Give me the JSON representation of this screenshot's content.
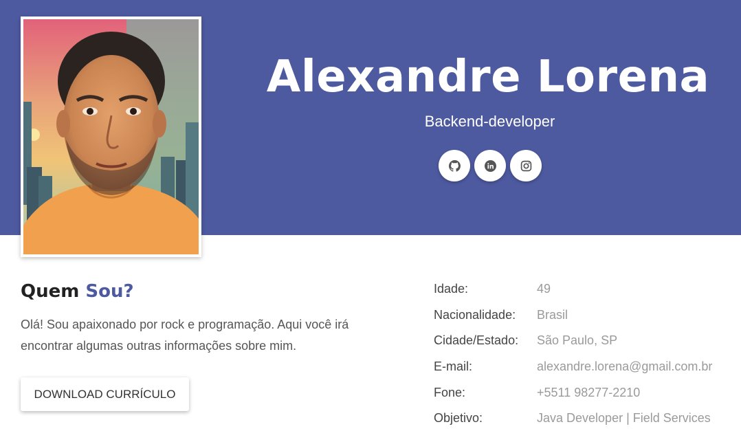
{
  "profile": {
    "name": "Alexandre Lorena",
    "role": "Backend-developer",
    "photo_alt": "avatar"
  },
  "socials": [
    {
      "icon": "github-icon"
    },
    {
      "icon": "linkedin-icon"
    },
    {
      "icon": "instagram-icon"
    }
  ],
  "about": {
    "title_start": "Quem",
    "title_accent": "Sou?",
    "text": "Olá! Sou apaixonado por rock e programação. Aqui você irá encontrar algumas outras informações sobre mim.",
    "download_label": "Download Currículo"
  },
  "info": [
    {
      "label": "Idade:",
      "value": "49"
    },
    {
      "label": "Nacionalidade:",
      "value": "Brasil"
    },
    {
      "label": "Cidade/Estado:",
      "value": "São Paulo, SP"
    },
    {
      "label": "E-mail:",
      "value": "alexandre.lorena@gmail.com.br"
    },
    {
      "label": "Fone:",
      "value": "+5511 98277-2210"
    },
    {
      "label": "Objetivo:",
      "value": "Java Developer | Field Services"
    }
  ],
  "colors": {
    "brand": "#4e5aa0",
    "text_dark": "#222222",
    "text_muted": "#9a9a9a"
  }
}
